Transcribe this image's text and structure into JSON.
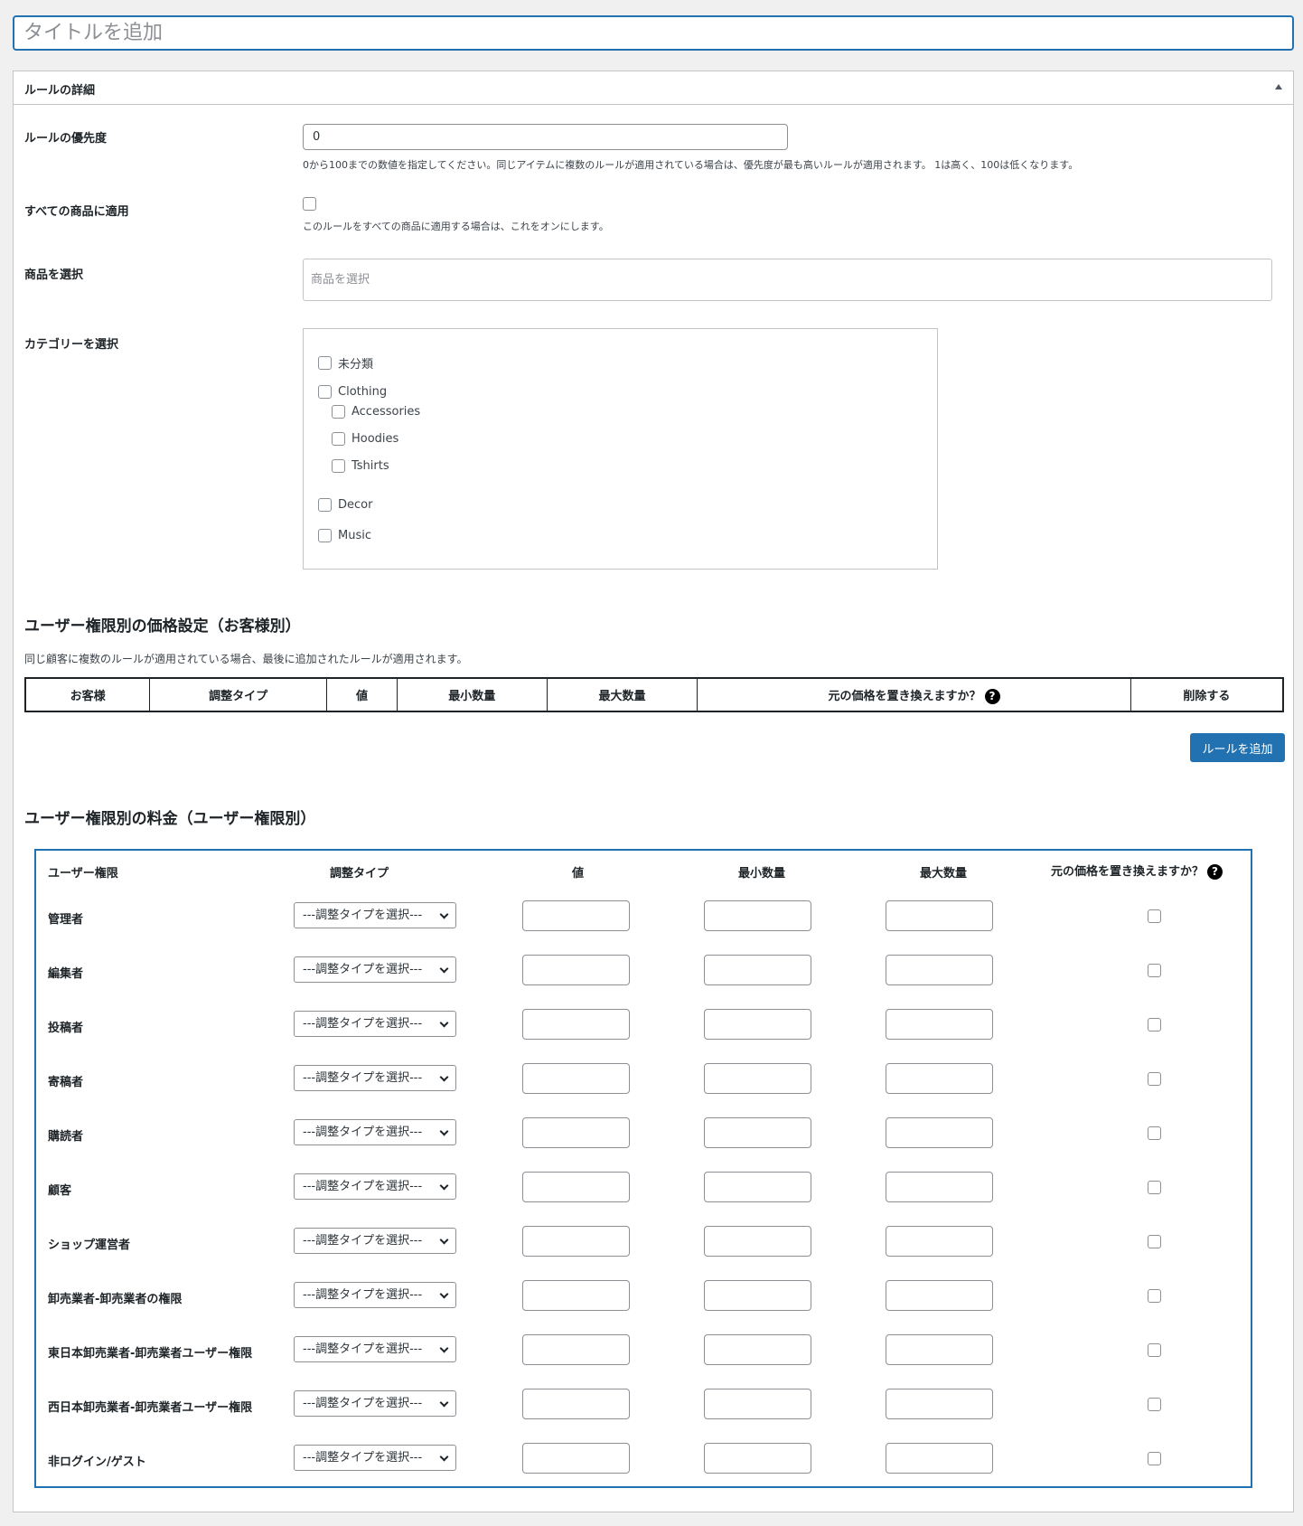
{
  "title_input": {
    "placeholder": "タイトルを追加"
  },
  "metabox": {
    "title": "ルールの詳細"
  },
  "priority": {
    "label": "ルールの優先度",
    "value": "0",
    "description": "0から100までの数値を指定してください。同じアイテムに複数のルールが適用されている場合は、優先度が最も高いルールが適用されます。 1は高く、100は低くなります。"
  },
  "apply_all": {
    "label": "すべての商品に適用",
    "description": "このルールをすべての商品に適用する場合は、これをオンにします。"
  },
  "product_select": {
    "label": "商品を選択",
    "placeholder": "商品を選択"
  },
  "category_select": {
    "label": "カテゴリーを選択",
    "items": [
      "未分類",
      "Clothing",
      "Accessories",
      "Hoodies",
      "Tshirts",
      "Decor",
      "Music"
    ]
  },
  "customer_pricing": {
    "heading": "ユーザー権限別の価格設定（お客様別）",
    "description": "同じ顧客に複数のルールが適用されている場合、最後に追加されたルールが適用されます。",
    "columns": [
      "お客様",
      "調整タイプ",
      "値",
      "最小数量",
      "最大数量",
      "元の価格を置き換えますか？",
      "削除する"
    ],
    "add_button": "ルールを追加"
  },
  "role_pricing": {
    "heading": "ユーザー権限別の料金（ユーザー権限別）",
    "columns": [
      "ユーザー権限",
      "調整タイプ",
      "値",
      "最小数量",
      "最大数量",
      "元の価格を置き換えますか？"
    ],
    "select_placeholder": "---調整タイプを選択---",
    "roles": [
      "管理者",
      "編集者",
      "投稿者",
      "寄稿者",
      "購読者",
      "顧客",
      "ショップ運営者",
      "卸売業者-卸売業者の権限",
      "東日本卸売業者-卸売業者ユーザー権限",
      "西日本卸売業者-卸売業者ユーザー権限",
      "非ログイン/ゲスト"
    ]
  },
  "icons": {
    "help": "question-circle-icon",
    "toggle": "triangle-up-icon",
    "chevron": "chevron-down-icon"
  },
  "colors": {
    "accent": "#2271b1",
    "background": "#f0f0f1"
  }
}
